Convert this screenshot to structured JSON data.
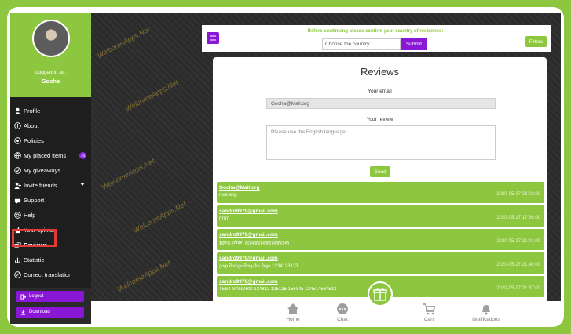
{
  "sidebar": {
    "logged_in_label": "Logged in as:",
    "user_name": "Gocha",
    "items": [
      {
        "label": "Profile",
        "icon": "user-icon"
      },
      {
        "label": "About",
        "icon": "info-icon"
      },
      {
        "label": "Policies",
        "icon": "policy-icon"
      },
      {
        "label": "My placed items",
        "icon": "globe-icon",
        "badge": "16"
      },
      {
        "label": "My giveaways",
        "icon": "giveaway-icon"
      },
      {
        "label": "Invite friends",
        "icon": "invite-icon"
      },
      {
        "label": "Support",
        "icon": "support-icon"
      },
      {
        "label": "Help",
        "icon": "help-icon"
      },
      {
        "label": "Your opinion",
        "icon": "opinion-icon"
      },
      {
        "label": "Reviews",
        "icon": "reviews-icon"
      },
      {
        "label": "Statistic",
        "icon": "chart-icon"
      },
      {
        "label": "Correct translation",
        "icon": "translate-icon"
      }
    ],
    "logout_label": "Logout",
    "download_label": "Download"
  },
  "topbar": {
    "confirm_text": "Before continuing please confirm your country of residence:",
    "country_placeholder": "Choose the country",
    "submit_label": "Submit",
    "filters_label": "Filters"
  },
  "watermark_text": "WelcomeApps.Net",
  "reviews": {
    "title": "Reviews",
    "email_label": "Your email",
    "email_value": "Gocha@Mail.org",
    "review_label": "Your review",
    "review_placeholder": "Please use the English language",
    "send_label": "Send",
    "items": [
      {
        "email": "Gocha@Mail.org",
        "text": "nice app",
        "date": "2020-05-27 23:03:00"
      },
      {
        "email": "sandro9970@gmail.com",
        "text": "rrrrrr",
        "date": "2020-05-17 17:56:00"
      },
      {
        "email": "sandro9970@gmail.com",
        "text": "ჯდიუ ერთი ტესტტესტტესტტესტ",
        "date": "2020-05-17 21:41:00"
      },
      {
        "email": "sandro9970@gmail.com",
        "text": "ქიდ მოსეი მოვახი მიჯი 1234123123",
        "date": "2020-05-17 21:40:00"
      },
      {
        "email": "sandro9970@gmail.com",
        "text": "TEST SANDRO 124812 125135 156345 134514534513",
        "date": "2020-05-17 21:37:00"
      }
    ]
  },
  "bottomnav": {
    "home": "Home",
    "chat": "Chat",
    "cart": "Cart",
    "notifications": "Notifications"
  },
  "colors": {
    "brand_green": "#8dc63f",
    "brand_purple": "#8a17d6",
    "sidebar_dark": "#1e1e1e",
    "highlight_red": "#e53935"
  }
}
